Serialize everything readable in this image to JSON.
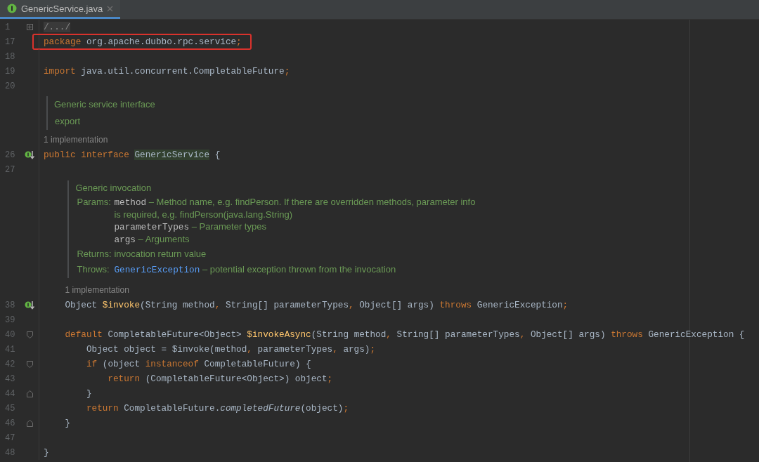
{
  "tabs": [
    {
      "label": "GenericService.java",
      "selected": true
    }
  ],
  "editor": {
    "rows": [
      {
        "number": "1",
        "boxed": false,
        "marker": {
          "kind": "folded"
        },
        "tokens": [
          {
            "kind": "folded",
            "text": "/.../"
          }
        ]
      },
      {
        "number": "17",
        "boxed": true,
        "tokens": [
          {
            "kind": "keyword",
            "text": "package "
          },
          {
            "kind": "plain",
            "text": "org.apache.dubbo.rpc.service"
          },
          {
            "kind": "punct",
            "text": ";"
          }
        ]
      },
      {
        "number": "18",
        "boxed": false,
        "tokens": []
      },
      {
        "number": "19",
        "boxed": false,
        "tokens": [
          {
            "kind": "keyword",
            "text": "import "
          },
          {
            "kind": "plain",
            "text": "java.util.concurrent.CompletableFuture"
          },
          {
            "kind": "punct",
            "text": ";"
          }
        ]
      },
      {
        "number": "20",
        "boxed": false,
        "tokens": []
      },
      {
        "number": "26",
        "boxed": false,
        "marker": {
          "kind": "implemented"
        },
        "doc": {
          "summary": "Generic service interface",
          "lines": [
            "export"
          ]
        },
        "hint": "1 implementation",
        "tokens": [
          {
            "kind": "keyword",
            "text": "public interface "
          },
          {
            "kind": "declared",
            "text": "GenericService"
          },
          {
            "kind": "plain",
            "text": " {"
          }
        ]
      },
      {
        "number": "27",
        "boxed": false,
        "tokens": []
      },
      {
        "number": "38",
        "boxed": false,
        "marker": {
          "kind": "implemented"
        },
        "doc": {
          "summary": "Generic invocation",
          "tags": [
            {
              "label": "Params:",
              "entries": [
                {
                  "name": "method",
                  "description": [
                    "– Method name, e.g. findPerson. If there are overridden methods, parameter info",
                    "is required, e.g. findPerson(java.lang.String)"
                  ]
                },
                {
                  "name": "parameterTypes",
                  "description": [
                    "– Parameter types"
                  ]
                },
                {
                  "name": "args",
                  "description": [
                    "– Arguments"
                  ]
                }
              ]
            },
            {
              "label": "Returns:",
              "entries": [
                {
                  "description": [
                    "invocation return value"
                  ]
                }
              ]
            },
            {
              "label": "Throws:",
              "entries": [
                {
                  "link": "GenericException",
                  "description": [
                    "– potential exception thrown from the invocation"
                  ]
                }
              ]
            }
          ]
        },
        "hint": "1 implementation",
        "tokens": [
          {
            "kind": "plain",
            "text": "    Object "
          },
          {
            "kind": "decl",
            "text": "$invoke"
          },
          {
            "kind": "plain",
            "text": "(String method"
          },
          {
            "kind": "punct",
            "text": ", "
          },
          {
            "kind": "plain",
            "text": "String[] parameterTypes"
          },
          {
            "kind": "punct",
            "text": ", "
          },
          {
            "kind": "plain",
            "text": "Object[] args) "
          },
          {
            "kind": "keyword",
            "text": "throws "
          },
          {
            "kind": "plain",
            "text": "GenericException"
          },
          {
            "kind": "punct",
            "text": ";"
          }
        ]
      },
      {
        "number": "39",
        "boxed": false,
        "tokens": []
      },
      {
        "number": "40",
        "boxed": false,
        "marker": {
          "kind": "fold-start"
        },
        "tokens": [
          {
            "kind": "keyword",
            "text": "    default "
          },
          {
            "kind": "plain",
            "text": "CompletableFuture<Object> "
          },
          {
            "kind": "decl",
            "text": "$invokeAsync"
          },
          {
            "kind": "plain",
            "text": "(String method"
          },
          {
            "kind": "punct",
            "text": ", "
          },
          {
            "kind": "plain",
            "text": "String[] parameterTypes"
          },
          {
            "kind": "punct",
            "text": ", "
          },
          {
            "kind": "plain",
            "text": "Object[] args) "
          },
          {
            "kind": "keyword",
            "text": "throws "
          },
          {
            "kind": "plain",
            "text": "GenericException {"
          }
        ]
      },
      {
        "number": "41",
        "boxed": false,
        "tokens": [
          {
            "kind": "plain",
            "text": "        Object object = $invoke(method"
          },
          {
            "kind": "punct",
            "text": ", "
          },
          {
            "kind": "plain",
            "text": "parameterTypes"
          },
          {
            "kind": "punct",
            "text": ", "
          },
          {
            "kind": "plain",
            "text": "args)"
          },
          {
            "kind": "punct",
            "text": ";"
          }
        ]
      },
      {
        "number": "42",
        "boxed": false,
        "marker": {
          "kind": "fold-start"
        },
        "tokens": [
          {
            "kind": "keyword",
            "text": "        if "
          },
          {
            "kind": "plain",
            "text": "(object "
          },
          {
            "kind": "keyword",
            "text": "instanceof "
          },
          {
            "kind": "plain",
            "text": "CompletableFuture) {"
          }
        ]
      },
      {
        "number": "43",
        "boxed": false,
        "tokens": [
          {
            "kind": "keyword",
            "text": "            return "
          },
          {
            "kind": "plain",
            "text": "(CompletableFuture<Object>) object"
          },
          {
            "kind": "punct",
            "text": ";"
          }
        ]
      },
      {
        "number": "44",
        "boxed": false,
        "marker": {
          "kind": "fold-end"
        },
        "tokens": [
          {
            "kind": "plain",
            "text": "        }"
          }
        ]
      },
      {
        "number": "45",
        "boxed": false,
        "tokens": [
          {
            "kind": "keyword",
            "text": "        return "
          },
          {
            "kind": "plain",
            "text": "CompletableFuture."
          },
          {
            "kind": "italic",
            "text": "completedFuture"
          },
          {
            "kind": "plain",
            "text": "(object)"
          },
          {
            "kind": "punct",
            "text": ";"
          }
        ]
      },
      {
        "number": "46",
        "boxed": false,
        "marker": {
          "kind": "fold-end"
        },
        "tokens": [
          {
            "kind": "plain",
            "text": "    }"
          }
        ]
      },
      {
        "number": "47",
        "boxed": false,
        "tokens": []
      },
      {
        "number": "48",
        "boxed": false,
        "tokens": [
          {
            "kind": "plain",
            "text": "}"
          }
        ]
      }
    ]
  }
}
